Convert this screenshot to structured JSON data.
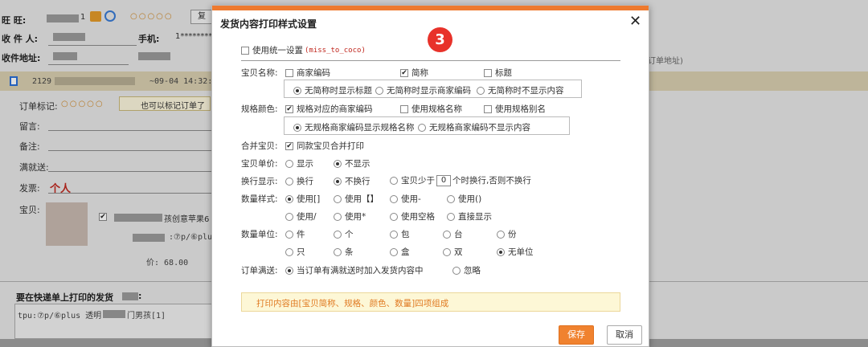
{
  "background": {
    "row1": {
      "label": "旺 旺:",
      "suffix": "1",
      "phone_label": "手机:",
      "phone": "1********"
    },
    "row2": {
      "label": "收 件 人:"
    },
    "row3": {
      "label": "收件地址:",
      "right_hint": "订单地址)"
    },
    "copy_btn": "复",
    "order_bar": {
      "id": "2129",
      "date": "~09-04 14:32:5"
    },
    "order_mark": {
      "label": "订单标记:",
      "hint": "也可以标记订单了"
    },
    "fields": {
      "message": "留言:",
      "remark": "备注:",
      "discount": "满就送:",
      "invoice": "发票:",
      "invoice_value": "个人",
      "item": "宝贝:"
    },
    "item": {
      "name": "孩创意苹果6",
      "sku": ":⑦p/⑥plu",
      "price": "价: 68.00"
    },
    "print_section": {
      "title": "要在快递单上打印的发货",
      "title_suffix": ":",
      "content": "tpu:⑦p/⑥plus 透明",
      "content_suffix": "门男孩[1]"
    }
  },
  "dialog": {
    "title": "发货内容打印样式设置",
    "close_icon": "close-icon",
    "badge": "3",
    "unified": {
      "label": "使用统一设置",
      "user": "(miss_to_coco)",
      "checked": false
    },
    "item_name": {
      "label": "宝贝名称:",
      "options": [
        {
          "label": "商家编码",
          "checked": false
        },
        {
          "label": "简称",
          "checked": true
        },
        {
          "label": "标题",
          "checked": false
        }
      ],
      "sub_options": [
        {
          "label": "无简称时显示标题",
          "checked": true
        },
        {
          "label": "无简称时显示商家编码",
          "checked": false
        },
        {
          "label": "无简称时不显示内容",
          "checked": false
        }
      ]
    },
    "spec_color": {
      "label": "规格颜色:",
      "options": [
        {
          "label": "规格对应的商家编码",
          "checked": true
        },
        {
          "label": "使用规格名称",
          "checked": false
        },
        {
          "label": "使用规格别名",
          "checked": false
        }
      ],
      "sub_options": [
        {
          "label": "无规格商家编码显示规格名称",
          "checked": true
        },
        {
          "label": "无规格商家编码不显示内容",
          "checked": false
        }
      ]
    },
    "merge": {
      "label": "合并宝贝:",
      "option": "同款宝贝合并打印",
      "checked": true
    },
    "unit_price": {
      "label": "宝贝单价:",
      "options": [
        {
          "label": "显示",
          "checked": false
        },
        {
          "label": "不显示",
          "checked": true
        }
      ]
    },
    "line_break": {
      "label": "换行显示:",
      "options": [
        {
          "label": "换行",
          "checked": false
        },
        {
          "label": "不换行",
          "checked": true
        }
      ],
      "conditional": {
        "prefix": "宝贝少于",
        "value": "0",
        "suffix": "个时换行,否则不换行",
        "checked": false
      }
    },
    "qty_style": {
      "label": "数量样式:",
      "row1": [
        {
          "label": "使用[]",
          "checked": true
        },
        {
          "label": "使用【】",
          "checked": false
        },
        {
          "label": "使用-",
          "checked": false
        },
        {
          "label": "使用()",
          "checked": false
        }
      ],
      "row2": [
        {
          "label": "使用/",
          "checked": false
        },
        {
          "label": "使用*",
          "checked": false
        },
        {
          "label": "使用空格",
          "checked": false
        },
        {
          "label": "直接显示",
          "checked": false
        }
      ]
    },
    "qty_unit": {
      "label": "数量单位:",
      "row1": [
        {
          "label": "件",
          "checked": false
        },
        {
          "label": "个",
          "checked": false
        },
        {
          "label": "包",
          "checked": false
        },
        {
          "label": "台",
          "checked": false
        },
        {
          "label": "份",
          "checked": false
        }
      ],
      "row2": [
        {
          "label": "只",
          "checked": false
        },
        {
          "label": "条",
          "checked": false
        },
        {
          "label": "盒",
          "checked": false
        },
        {
          "label": "双",
          "checked": false
        },
        {
          "label": "无单位",
          "checked": true
        }
      ]
    },
    "order_gift": {
      "label": "订单满送:",
      "options": [
        {
          "label": "当订单有满就送时加入发货内容中",
          "checked": true
        },
        {
          "label": "忽略",
          "checked": false
        }
      ]
    },
    "note": "打印内容由[宝贝简称、规格、颜色、数量]四项组成",
    "buttons": {
      "save": "保存",
      "cancel": "取消"
    }
  }
}
